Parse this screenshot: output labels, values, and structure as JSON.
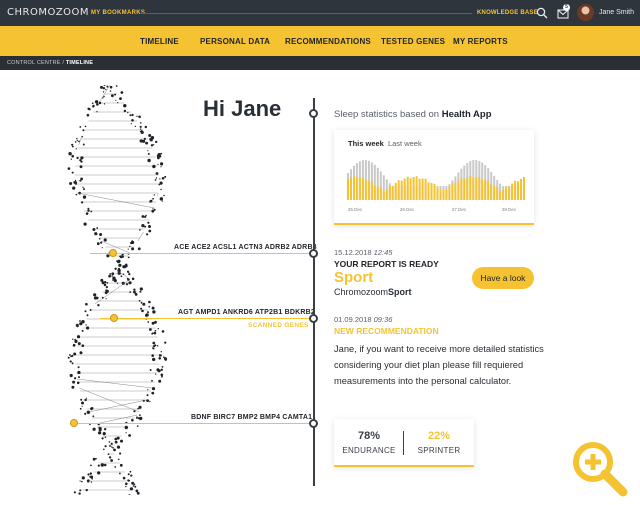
{
  "topbar": {
    "logo": "CHROMOZOOM",
    "bookmarks": "MY BOOKMARKS",
    "knowledge_base": "KNOWLEDGE BASE",
    "mail_count": "5",
    "user_name": "Jane Smith"
  },
  "nav": {
    "items": [
      "TIMELINE",
      "PERSONAL DATA",
      "RECOMMENDATIONS",
      "TESTED GENES",
      "MY REPORTS"
    ]
  },
  "breadcrumb": {
    "root": "CONTROL CENTRE",
    "separator": " / ",
    "current": "TIMELINE"
  },
  "greeting": "Hi Jane",
  "sleep": {
    "prefix": "Sleep statistics based on ",
    "source": "Health App",
    "tab_this": "This week",
    "tab_last": "Last week",
    "dates": [
      "25.Dec",
      "26.Dec",
      "27.Dec",
      "28.Dec"
    ]
  },
  "report": {
    "date": "15.12.2018",
    "time": "12:45",
    "title": "YOUR REPORT IS READY",
    "name": "Sport",
    "sub_prefix": "Chromozoom",
    "sub_bold": "Sport",
    "button": "Have a look"
  },
  "recommendation": {
    "date": "01.09.2018",
    "time": "09:36",
    "title": "NEW RECOMMENDATION",
    "text": "Jane, if you want to receive more detailed statistics considering your diet plan please fill requiered measurements into the personal calculator."
  },
  "stats": {
    "endurance_value": "78%",
    "endurance_label": "ENDURANCE",
    "sprinter_value": "22%",
    "sprinter_label": "SPRINTER"
  },
  "genes": {
    "group1": "ACE ACE2 ACSL1 ACTN3 ADRB2 ADRB3",
    "group2": "AGT AMPD1 ANKRD6 ATP2B1 BDKRB2",
    "scanned": "SCANNED GENES",
    "group3": "BDNF BIRC7 BMP2 BMP4 CAMTA1"
  },
  "colors": {
    "accent": "#f5c332",
    "dark": "#2f353c"
  },
  "icons": {
    "search": "search-icon",
    "mail": "mail-icon",
    "zoom": "zoom-in-icon"
  }
}
